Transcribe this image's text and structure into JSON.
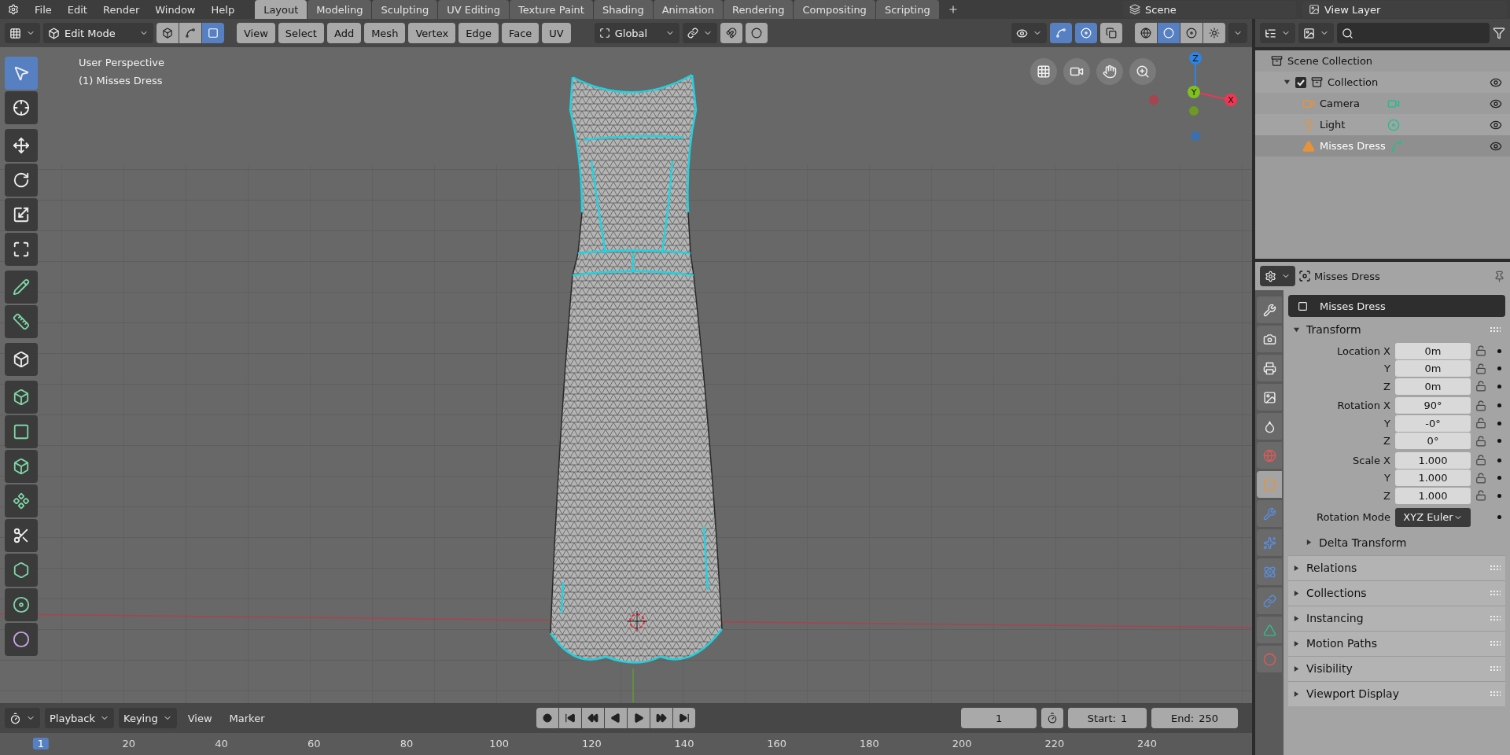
{
  "top_bar": {
    "menus": [
      "File",
      "Edit",
      "Render",
      "Window",
      "Help"
    ],
    "workspaces": [
      {
        "label": "Layout",
        "selected": true
      },
      {
        "label": "Modeling",
        "selected": false
      },
      {
        "label": "Sculpting",
        "selected": false
      },
      {
        "label": "UV Editing",
        "selected": false
      },
      {
        "label": "Texture Paint",
        "selected": false
      },
      {
        "label": "Shading",
        "selected": false
      },
      {
        "label": "Animation",
        "selected": false
      },
      {
        "label": "Rendering",
        "selected": false
      },
      {
        "label": "Compositing",
        "selected": false
      },
      {
        "label": "Scripting",
        "selected": false
      }
    ],
    "scene": "Scene",
    "view_layer": "View Layer"
  },
  "viewport_header": {
    "mode": "Edit Mode",
    "select_modes": [
      {
        "kind": "vertex",
        "selected": false
      },
      {
        "kind": "edge",
        "selected": false
      },
      {
        "kind": "face",
        "selected": true
      }
    ],
    "menus": [
      "View",
      "Select",
      "Add",
      "Mesh",
      "Vertex",
      "Edge",
      "Face",
      "UV"
    ],
    "orientation": "Global",
    "snapping": [
      {
        "kind": "snap",
        "on": false
      },
      {
        "kind": "proportional",
        "on": false
      }
    ],
    "display": [
      {
        "kind": "gizmo",
        "on": true
      },
      {
        "kind": "overlay",
        "on": true
      },
      {
        "kind": "xray",
        "on": false
      }
    ],
    "shading": [
      {
        "kind": "wireframe",
        "selected": false
      },
      {
        "kind": "solid",
        "selected": true
      },
      {
        "kind": "material",
        "selected": false
      },
      {
        "kind": "rendered",
        "selected": false
      }
    ]
  },
  "viewport": {
    "info": [
      "User Perspective",
      "(1) Misses Dress"
    ],
    "tools": [
      {
        "kind": "select",
        "selected": true
      },
      {
        "kind": "cursor",
        "selected": false
      },
      {
        "kind": "move",
        "selected": false
      },
      {
        "kind": "rotate",
        "selected": false
      },
      {
        "kind": "scale",
        "selected": false
      },
      {
        "kind": "transform",
        "selected": false
      },
      {
        "kind": "annotate",
        "selected": false
      },
      {
        "kind": "measure",
        "selected": false
      },
      {
        "kind": "add-cube",
        "selected": false
      },
      {
        "kind": "extrude",
        "selected": false
      },
      {
        "kind": "inset",
        "selected": false
      },
      {
        "kind": "bevel",
        "selected": false
      },
      {
        "kind": "loop-cut",
        "selected": false
      },
      {
        "kind": "knife",
        "selected": false
      },
      {
        "kind": "poly-build",
        "selected": false
      },
      {
        "kind": "spin",
        "selected": false
      },
      {
        "kind": "smooth",
        "selected": false
      }
    ],
    "gizmo": [
      {
        "label": "Z",
        "color": "#2f83e3"
      },
      {
        "label": "Y",
        "color": "#7fbf1f"
      },
      {
        "label": "X",
        "color": "#ef3652"
      }
    ]
  },
  "outliner": {
    "root": "Scene Collection",
    "tree": [
      {
        "label": "Collection",
        "checked": true,
        "expanded": true,
        "children": [
          {
            "label": "Camera",
            "kind": "camera",
            "selected": false
          },
          {
            "label": "Light",
            "kind": "light",
            "selected": false
          },
          {
            "label": "Misses Dress",
            "kind": "mesh",
            "selected": true
          }
        ]
      }
    ]
  },
  "properties": {
    "object": "Misses Dress",
    "name": "Misses Dress",
    "tabs": [
      {
        "kind": "tool",
        "selected": false
      },
      {
        "kind": "render",
        "selected": false
      },
      {
        "kind": "output",
        "selected": false
      },
      {
        "kind": "view-layer",
        "selected": false
      },
      {
        "kind": "scene",
        "selected": false
      },
      {
        "kind": "world",
        "selected": false
      },
      {
        "kind": "object",
        "selected": true
      },
      {
        "kind": "modifier",
        "selected": false
      },
      {
        "kind": "particles",
        "selected": false
      },
      {
        "kind": "physics",
        "selected": false
      },
      {
        "kind": "constraints",
        "selected": false
      },
      {
        "kind": "data",
        "selected": false
      },
      {
        "kind": "material",
        "selected": false
      }
    ],
    "transform": {
      "title": "Transform",
      "expanded": true,
      "rows": [
        {
          "label": "Location X",
          "value": "0m"
        },
        {
          "label": "Y",
          "value": "0m"
        },
        {
          "label": "Z",
          "value": "0m"
        },
        {
          "label": "Rotation X",
          "value": "90°"
        },
        {
          "label": "Y",
          "value": "-0°"
        },
        {
          "label": "Z",
          "value": "0°"
        },
        {
          "label": "Scale X",
          "value": "1.000"
        },
        {
          "label": "Y",
          "value": "1.000"
        },
        {
          "label": "Z",
          "value": "1.000"
        }
      ],
      "rotation_mode": {
        "label": "Rotation Mode",
        "value": "XYZ Euler"
      },
      "subpanels": [
        {
          "label": "Delta Transform",
          "expanded": false
        }
      ]
    },
    "panels": [
      {
        "label": "Relations",
        "expanded": false
      },
      {
        "label": "Collections",
        "expanded": false
      },
      {
        "label": "Instancing",
        "expanded": false
      },
      {
        "label": "Motion Paths",
        "expanded": false
      },
      {
        "label": "Visibility",
        "expanded": false
      },
      {
        "label": "Viewport Display",
        "expanded": false
      }
    ]
  },
  "timeline": {
    "menus": [
      "Playback",
      "Keying",
      "View",
      "Marker"
    ],
    "current_frame": "1",
    "start": {
      "label": "Start:",
      "value": "1"
    },
    "end": {
      "label": "End:",
      "value": "250"
    },
    "ruler": [
      "1",
      "20",
      "40",
      "60",
      "80",
      "100",
      "120",
      "140",
      "160",
      "180",
      "200",
      "220",
      "240"
    ]
  }
}
